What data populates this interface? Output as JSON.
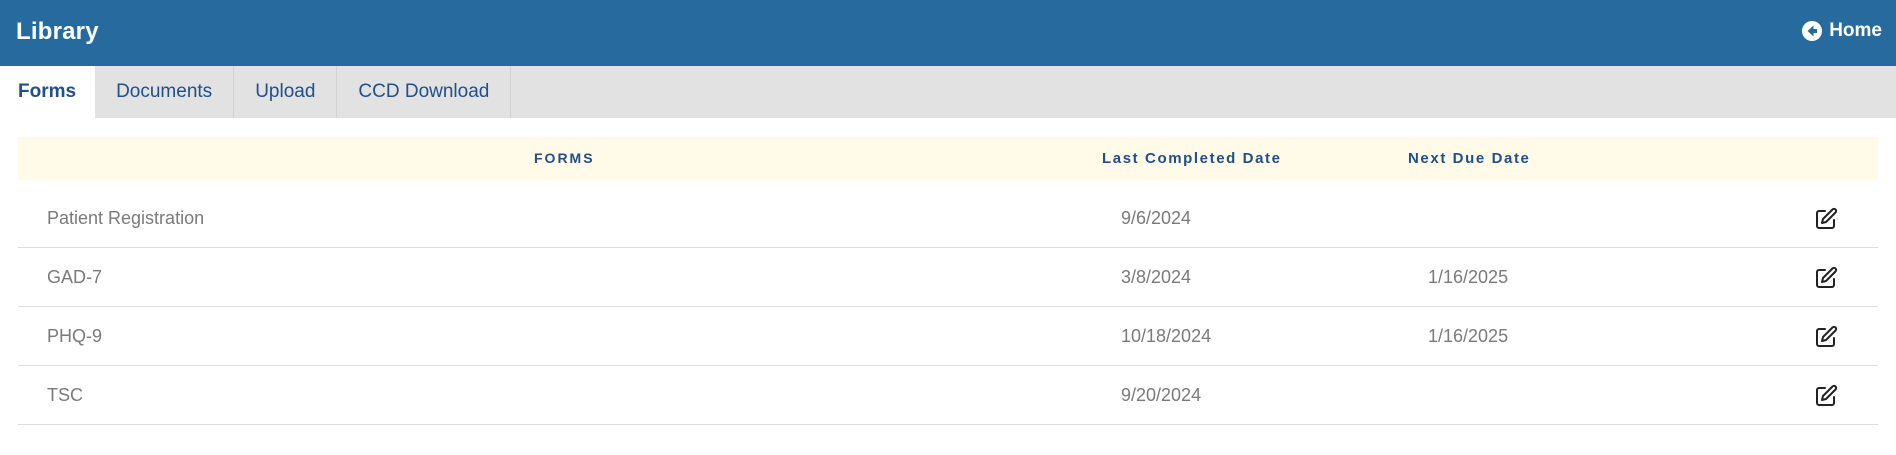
{
  "header": {
    "title": "Library",
    "home_label": "Home"
  },
  "tabs": [
    {
      "label": "Forms",
      "active": true
    },
    {
      "label": "Documents",
      "active": false
    },
    {
      "label": "Upload",
      "active": false
    },
    {
      "label": "CCD Download",
      "active": false
    }
  ],
  "table": {
    "columns": {
      "forms": "FORMS",
      "last_completed": "Last Completed Date",
      "next_due": "Next Due Date"
    },
    "rows": [
      {
        "name": "Patient Registration",
        "last_completed": "9/6/2024",
        "next_due": "",
        "action_icon": "edit-icon"
      },
      {
        "name": "GAD-7",
        "last_completed": "3/8/2024",
        "next_due": "1/16/2025",
        "action_icon": "edit-icon"
      },
      {
        "name": "PHQ-9",
        "last_completed": "10/18/2024",
        "next_due": "1/16/2025",
        "action_icon": "edit-icon"
      },
      {
        "name": "TSC",
        "last_completed": "9/20/2024",
        "next_due": "",
        "action_icon": "edit-icon"
      }
    ]
  },
  "colors": {
    "header_bg": "#276b9e",
    "tab_bar_bg": "#e2e2e2",
    "accent_text": "#204f8a",
    "table_header_bg": "#fffbe8",
    "cell_text": "#7a7a7a"
  },
  "icons": {
    "home": "arrow-circle-left-icon",
    "edit": "edit-icon"
  }
}
